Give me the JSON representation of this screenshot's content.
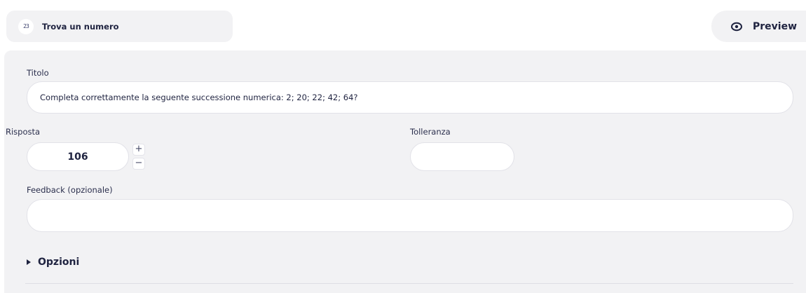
{
  "header": {
    "question_type_label": "Trova un numero",
    "question_type_icon": "numbers-icon",
    "question_type_icon_glyph": "23",
    "preview_label": "Preview",
    "preview_icon": "eye-icon"
  },
  "form": {
    "title": {
      "label": "Titolo",
      "value": "Completa correttamente la seguente successione numerica: 2; 20; 22; 42; 64?"
    },
    "answer": {
      "label": "Risposta",
      "value": "106",
      "increment_symbol": "+",
      "decrement_symbol": "−"
    },
    "tolerance": {
      "label": "Tolleranza",
      "value": ""
    },
    "feedback": {
      "label": "Feedback (opzionale)",
      "value": ""
    },
    "options": {
      "label": "Opzioni",
      "expanded": false
    }
  },
  "colors": {
    "panel_background": "#f2f2f4",
    "text_primary": "#1f2340",
    "field_background": "#ffffff"
  }
}
